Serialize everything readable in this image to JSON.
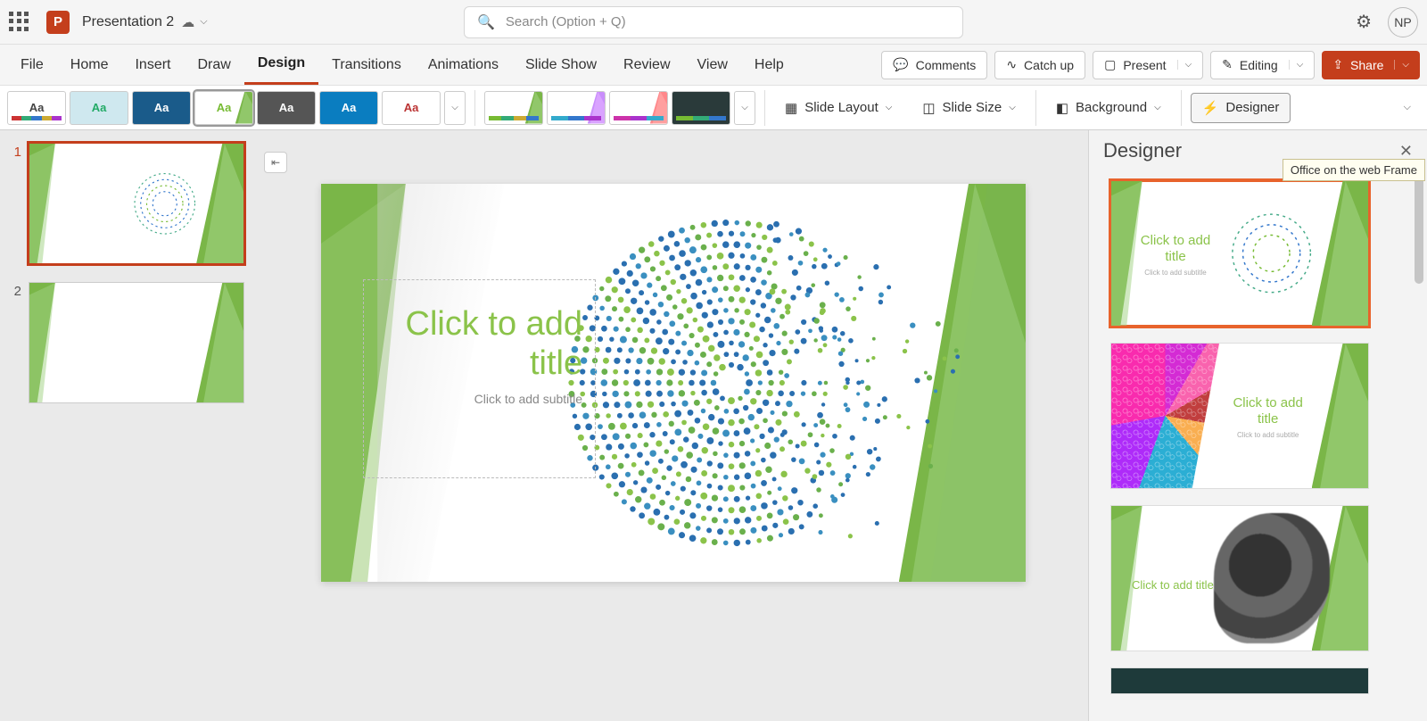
{
  "titlebar": {
    "docName": "Presentation 2",
    "searchPlaceholder": "Search (Option + Q)",
    "avatar": "NP"
  },
  "ribbon": {
    "tabs": [
      "File",
      "Home",
      "Insert",
      "Draw",
      "Design",
      "Transitions",
      "Animations",
      "Slide Show",
      "Review",
      "View",
      "Help"
    ],
    "activeTab": "Design",
    "comments": "Comments",
    "catchup": "Catch up",
    "present": "Present",
    "editing": "Editing",
    "share": "Share"
  },
  "designBar": {
    "slideLayout": "Slide Layout",
    "slideSize": "Slide Size",
    "background": "Background",
    "designer": "Designer"
  },
  "thumbs": {
    "n1": "1",
    "n2": "2"
  },
  "slide": {
    "titlePlaceholder": "Click to add title",
    "subtitlePlaceholder": "Click to add subtitle"
  },
  "designerPane": {
    "title": "Designer",
    "tooltip": "Office on the web Frame",
    "idea1": {
      "title": "Click to add title",
      "sub": "Click to add subtitle"
    },
    "idea2": {
      "title": "Click to add title",
      "sub": "Click to add subtitle"
    },
    "idea3": {
      "title": "Click to add title"
    }
  }
}
